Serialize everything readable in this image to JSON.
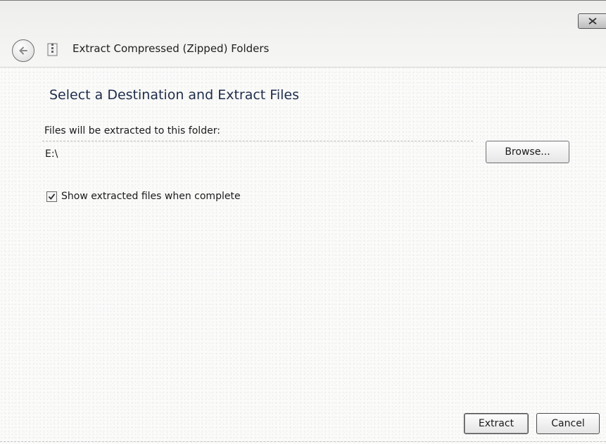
{
  "window": {
    "title": "Extract Compressed (Zipped) Folders"
  },
  "titlebar": {
    "close_icon": "close-icon",
    "back_icon": "back-arrow-icon",
    "app_icon": "zip-folder-icon"
  },
  "main": {
    "heading": "Select a Destination and Extract Files",
    "destination_label": "Files will be extracted to this folder:",
    "destination_value": "E:\\",
    "browse_label": "Browse...",
    "show_files_label": "Show extracted files when complete",
    "show_files_checked": true
  },
  "footer": {
    "extract_label": "Extract",
    "cancel_label": "Cancel"
  }
}
